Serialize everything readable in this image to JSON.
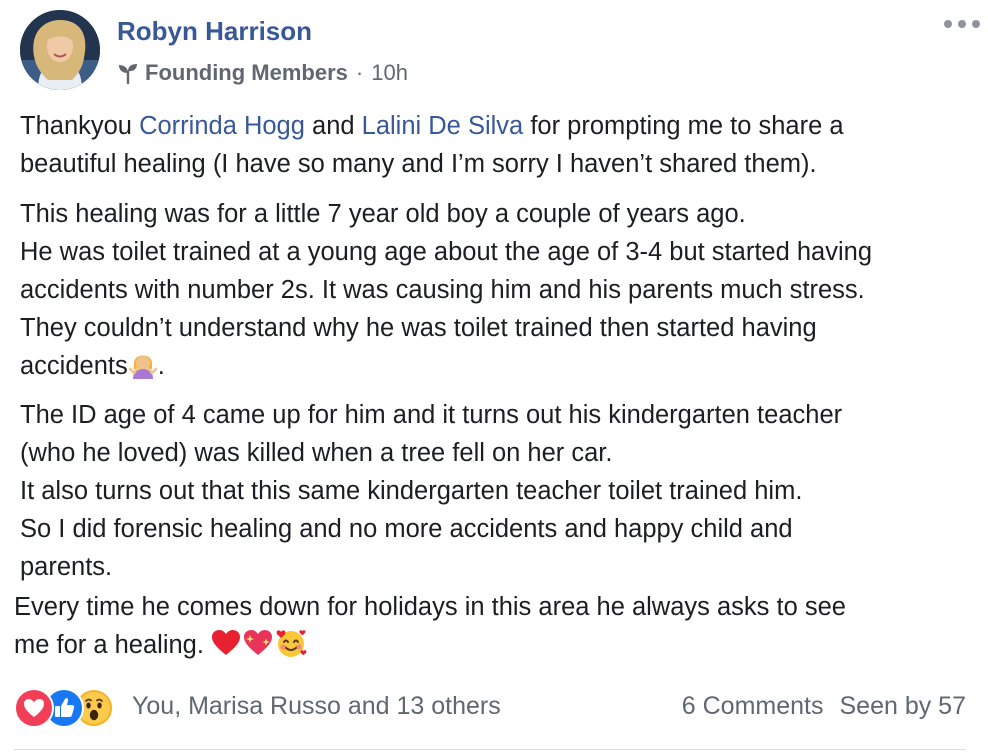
{
  "post": {
    "author": {
      "name": "Robyn Harrison"
    },
    "group": {
      "label": "Founding Members",
      "icon": "sprout-icon"
    },
    "separator": "·",
    "timestamp": "10h",
    "more_icon": "more-options-icon",
    "mention_color": "#385898",
    "body": {
      "p1": {
        "l1": {
          "pre": "Thankyou ",
          "mention1": "Corrinda Hogg",
          "mid": " and ",
          "mention2": "Lalini De Silva",
          "post": " for prompting me to share a"
        },
        "l2": "beautiful healing (I have so many and I’m sorry I haven’t shared them)."
      },
      "p2": {
        "l1": "This healing was for a little 7 year old boy a couple of years ago.",
        "l2": "He was toilet trained at a young age about the age of 3-4 but started having",
        "l3": "accidents with number 2s. It was causing him and his parents much stress.",
        "l4": "They couldn’t understand why he was toilet trained then started having",
        "l5": "accidents",
        "l5_end": ".",
        "l5_emoji": "woman-shrugging-emoji"
      },
      "p3": {
        "l1": "The ID age of 4 came up for him and it turns out his kindergarten teacher",
        "l2": "(who he loved) was killed when a tree fell on her car.",
        "l3": "It also turns out that this same kindergarten teacher toilet trained him.",
        "l4": "So I did forensic healing and no more accidents and happy child and",
        "l5": "parents."
      },
      "p4": {
        "l1": "Every time he comes down for holidays in this area he always asks to see",
        "l2": "me for a healing. ",
        "emojis": [
          "red-heart-emoji",
          "sparkling-heart-emoji",
          "smiling-face-with-hearts-emoji"
        ]
      }
    },
    "reactions": {
      "icons": [
        "love-reaction-icon",
        "like-reaction-icon",
        "wow-reaction-icon"
      ],
      "colors": {
        "love": "#f33e58",
        "like": "#1877f2",
        "wow": "#f7b125"
      },
      "summary": "You, Marisa Russo and 13 others"
    },
    "stats": {
      "comments": "6 Comments",
      "seen_by": "Seen by 57"
    }
  }
}
